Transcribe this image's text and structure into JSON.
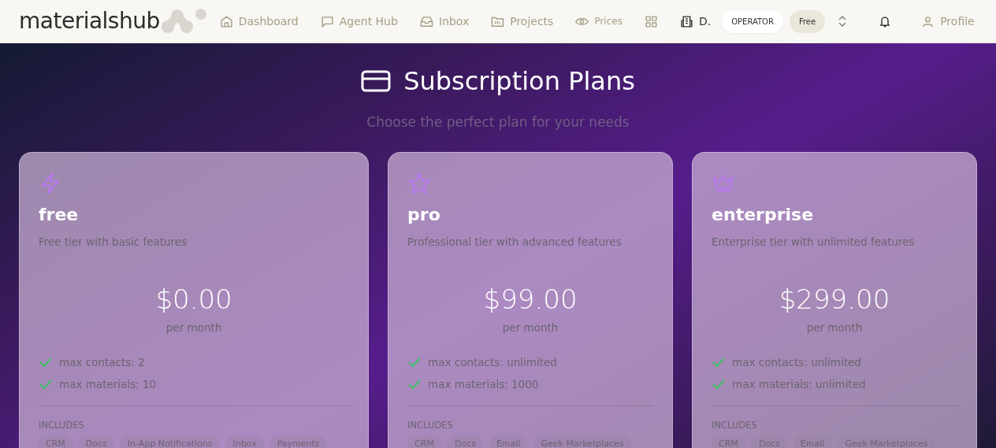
{
  "brand": {
    "name": "materialshub"
  },
  "nav": [
    {
      "label": "Dashboard"
    },
    {
      "label": "Agent Hub"
    },
    {
      "label": "Inbox"
    },
    {
      "label": "Projects"
    },
    {
      "label": "Prices"
    }
  ],
  "org_label": "D.",
  "role_badge": "OPERATOR",
  "plan_badge": "Free",
  "profile": "Profile",
  "header": {
    "title": "Subscription Plans",
    "subtitle": "Choose the perfect plan for your needs"
  },
  "plans": [
    {
      "name": "free",
      "description": "Free tier with basic features",
      "price": "$0.00",
      "period": "per month",
      "limits": [
        "max contacts: 2",
        "max materials: 10"
      ],
      "includes_label": "INCLUDES",
      "includes": [
        "CRM",
        "Docs",
        "In-App Notifications",
        "Inbox",
        "Payments"
      ]
    },
    {
      "name": "pro",
      "description": "Professional tier with advanced features",
      "price": "$99.00",
      "period": "per month",
      "limits": [
        "max contacts: unlimited",
        "max materials: 1000"
      ],
      "includes_label": "INCLUDES",
      "includes": [
        "CRM",
        "Docs",
        "Email",
        "Geek Marketplaces"
      ]
    },
    {
      "name": "enterprise",
      "description": "Enterprise tier with unlimited features",
      "price": "$299.00",
      "period": "per month",
      "limits": [
        "max contacts: unlimited",
        "max materials: unlimited"
      ],
      "includes_label": "INCLUDES",
      "includes": [
        "CRM",
        "Docs",
        "Email",
        "Geek Marketplaces"
      ]
    }
  ]
}
